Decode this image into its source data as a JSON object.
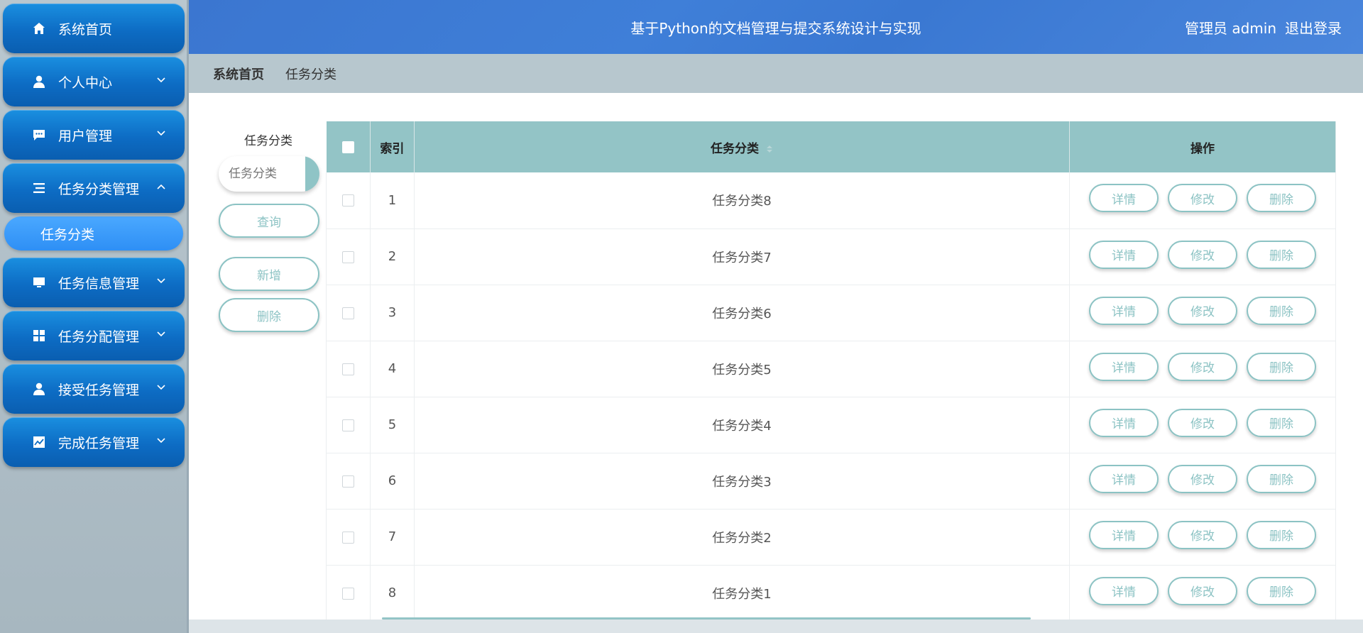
{
  "header": {
    "title": "基于Python的文档管理与提交系统设计与实现",
    "user": "管理员 admin",
    "logout": "退出登录"
  },
  "sidebar": {
    "items": [
      {
        "label": "系统首页",
        "icon": "home-icon",
        "arrow": ""
      },
      {
        "label": "个人中心",
        "icon": "person-icon",
        "arrow": "down"
      },
      {
        "label": "用户管理",
        "icon": "chat-icon",
        "arrow": "down"
      },
      {
        "label": "任务分类管理",
        "icon": "list-icon",
        "arrow": "up"
      },
      {
        "label": "任务信息管理",
        "icon": "monitor-icon",
        "arrow": "down"
      },
      {
        "label": "任务分配管理",
        "icon": "grid-icon",
        "arrow": "down"
      },
      {
        "label": "接受任务管理",
        "icon": "person-icon",
        "arrow": "down"
      },
      {
        "label": "完成任务管理",
        "icon": "chart-icon",
        "arrow": "down"
      }
    ],
    "submenu": {
      "label": "任务分类"
    }
  },
  "breadcrumb": {
    "home": "系统首页",
    "current": "任务分类"
  },
  "filter": {
    "label": "任务分类",
    "placeholder": "任务分类",
    "query_button": "查询",
    "add_button": "新增",
    "delete_button": "删除"
  },
  "table": {
    "columns": {
      "index": "索引",
      "name": "任务分类",
      "ops": "操作"
    },
    "ops": {
      "detail": "详情",
      "edit": "修改",
      "delete": "删除"
    },
    "rows": [
      {
        "index": "1",
        "name": "任务分类8"
      },
      {
        "index": "2",
        "name": "任务分类7"
      },
      {
        "index": "3",
        "name": "任务分类6"
      },
      {
        "index": "4",
        "name": "任务分类5"
      },
      {
        "index": "5",
        "name": "任务分类4"
      },
      {
        "index": "6",
        "name": "任务分类3"
      },
      {
        "index": "7",
        "name": "任务分类2"
      },
      {
        "index": "8",
        "name": "任务分类1"
      }
    ]
  },
  "colors": {
    "accent": "#93c4c6",
    "header_blue": "#3b76d0",
    "menu_blue": "#0d6cc4"
  }
}
